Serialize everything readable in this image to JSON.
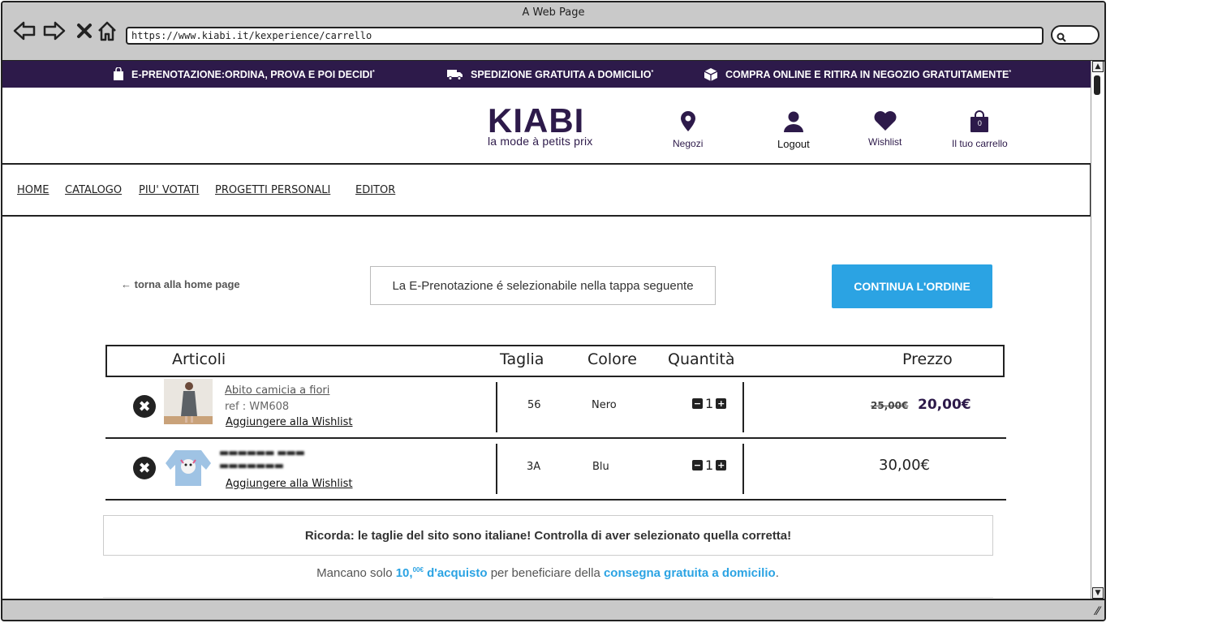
{
  "browser": {
    "window_title": "A Web Page",
    "url": "https://www.kiabi.it/kexperience/carrello"
  },
  "promo_bar": {
    "items": [
      {
        "text": "E-PRENOTAZIONE:ORDINA, PROVA E POI DECIDI",
        "mark": "*"
      },
      {
        "text": "SPEDIZIONE GRATUITA A DOMICILIO",
        "mark": "*"
      },
      {
        "text": "COMPRA ONLINE E RITIRA IN NEGOZIO GRATUITAMENTE",
        "mark": "*"
      }
    ]
  },
  "header": {
    "logo": "KIABI",
    "tagline": "la mode à petits prix",
    "stores_label": "Negozi",
    "account_label": "Logout",
    "wishlist_label": "Wishlist",
    "cart_label": "Il tuo carrello",
    "cart_count": "0"
  },
  "nav": {
    "items": [
      "HOME",
      "CATALOGO",
      "PIU' VOTATI",
      "PROGETTI PERSONALI",
      "EDITOR"
    ]
  },
  "cart_top": {
    "back_link": "← torna alla home page",
    "notice": "La E-Prenotazione é selezionabile nella tappa seguente",
    "continue_button": "CONTINUA L'ORDINE"
  },
  "table": {
    "headers": {
      "items": "Articoli",
      "size": "Taglia",
      "color": "Colore",
      "quantity": "Quantità",
      "price": "Prezzo"
    },
    "rows": [
      {
        "name": "Abito camicia a fiori",
        "ref": "ref : WM608",
        "wishlist": "Aggiungere alla Wishlist",
        "size": "56",
        "color": "Nero",
        "qty": "1",
        "old_price": "25,00€",
        "price": "20,00€"
      },
      {
        "name": "",
        "ref": "",
        "wishlist": "Aggiungere alla Wishlist",
        "size": "3A",
        "color": "Blu",
        "qty": "1",
        "old_price": "",
        "price": "30,00€"
      }
    ]
  },
  "reminder": "Ricorda: le taglie del sito sono italiane! Controlla di aver selezionato quella corretta!",
  "shipping_message": {
    "prefix": "Mancano solo",
    "amount_int": "10,",
    "amount_dec": "00€",
    "amount_suffix": "d'acquisto",
    "middle": "per beneficiare della",
    "link": "consegna gratuita a domicilio",
    "end": "."
  },
  "colors": {
    "brand_purple": "#2d1a4a",
    "accent_blue": "#2ba3e3"
  }
}
